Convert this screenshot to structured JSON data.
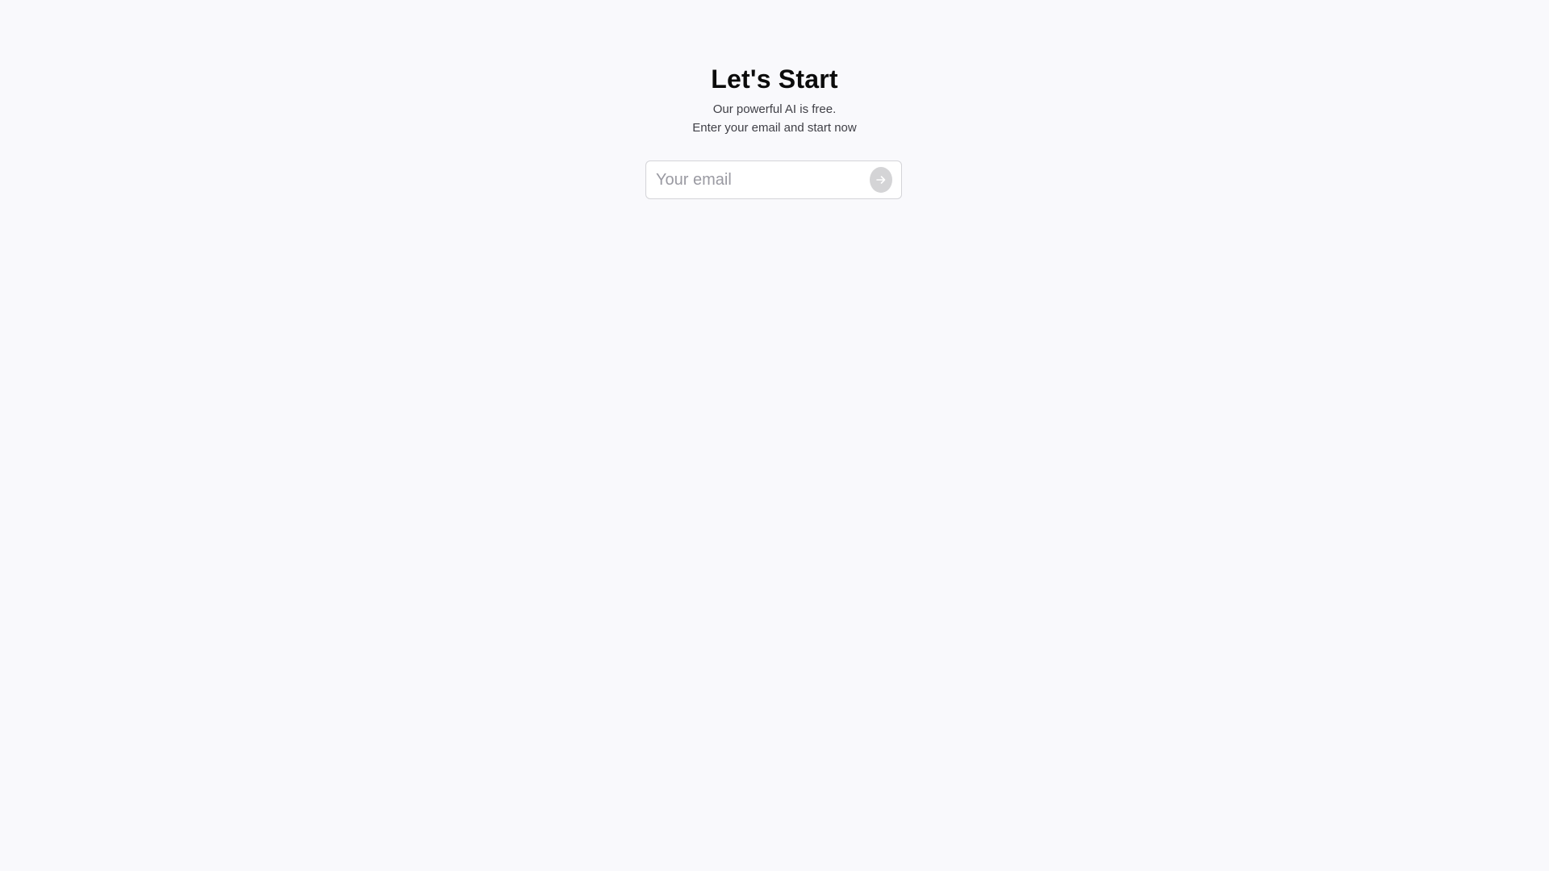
{
  "hero": {
    "title": "Let's Start",
    "subtitle_line1": "Our powerful AI is free.",
    "subtitle_line2": "Enter your email and start now"
  },
  "email_form": {
    "placeholder": "Your email",
    "value": "",
    "submit_icon": "arrow-right-icon"
  },
  "colors": {
    "background": "#f9f9fc",
    "title": "#0b0b0b",
    "subtitle": "#3f3f46",
    "input_border": "#d4d4d8",
    "submit_button": "#d4d4d6"
  }
}
